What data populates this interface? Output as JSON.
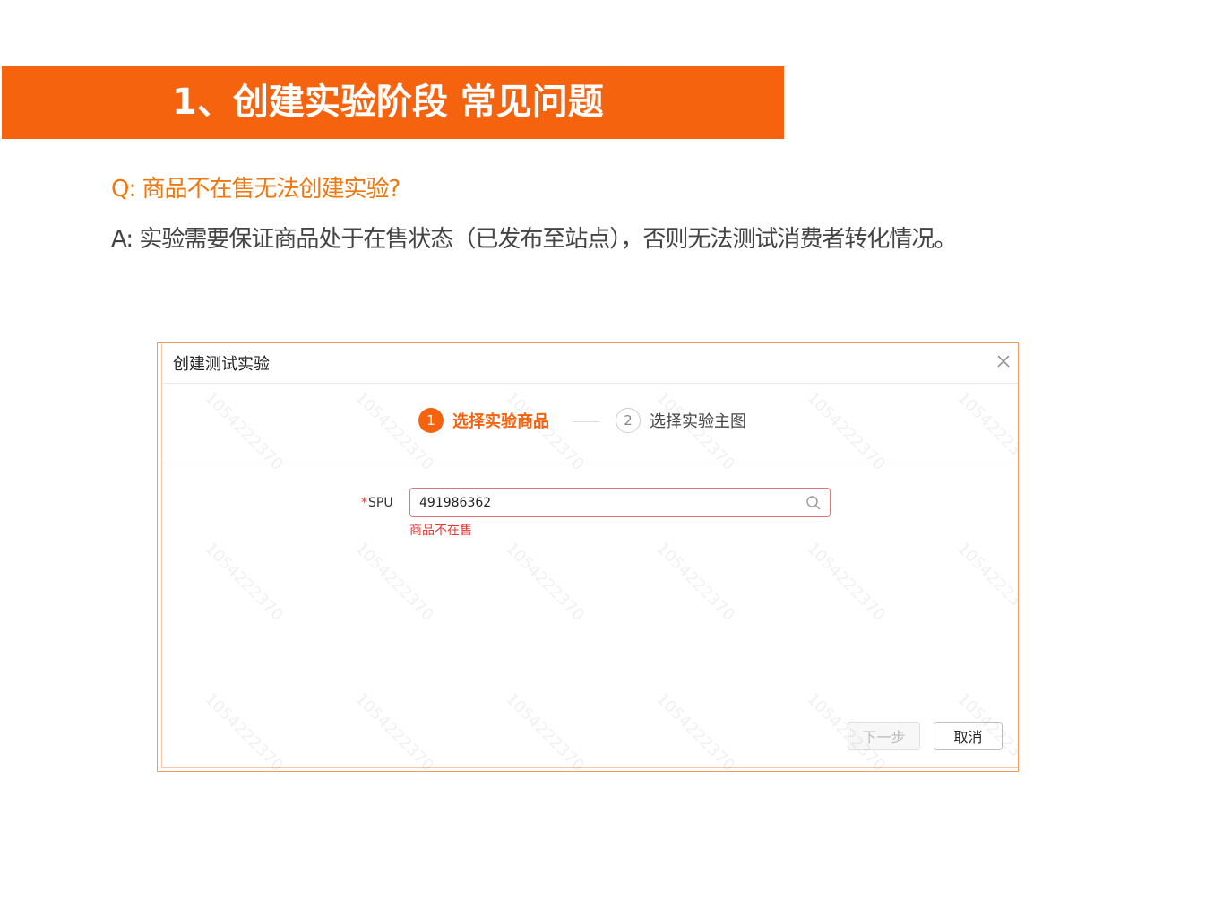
{
  "slide": {
    "banner_title": "1、创建实验阶段 常见问题",
    "question": "Q: 商品不在售无法创建实验?",
    "answer": "A: 实验需要保证商品处于在售状态（已发布至站点），否则无法测试消费者转化情况。"
  },
  "dialog": {
    "title": "创建测试实验",
    "close_icon": "close-icon",
    "steps": [
      {
        "number": "1",
        "label": "选择实验商品",
        "state": "active"
      },
      {
        "number": "2",
        "label": "选择实验主图",
        "state": "pending"
      }
    ],
    "form": {
      "spu_required_mark": "*",
      "spu_label": "SPU",
      "spu_value": "491986362",
      "search_icon": "search-icon",
      "error_message": "商品不在售"
    },
    "buttons": {
      "next_label": "下一步",
      "cancel_label": "取消"
    },
    "watermark_text": "1054222370"
  },
  "colors": {
    "accent": "#f5630f",
    "question_text": "#f0780f",
    "error": "#e53935"
  }
}
